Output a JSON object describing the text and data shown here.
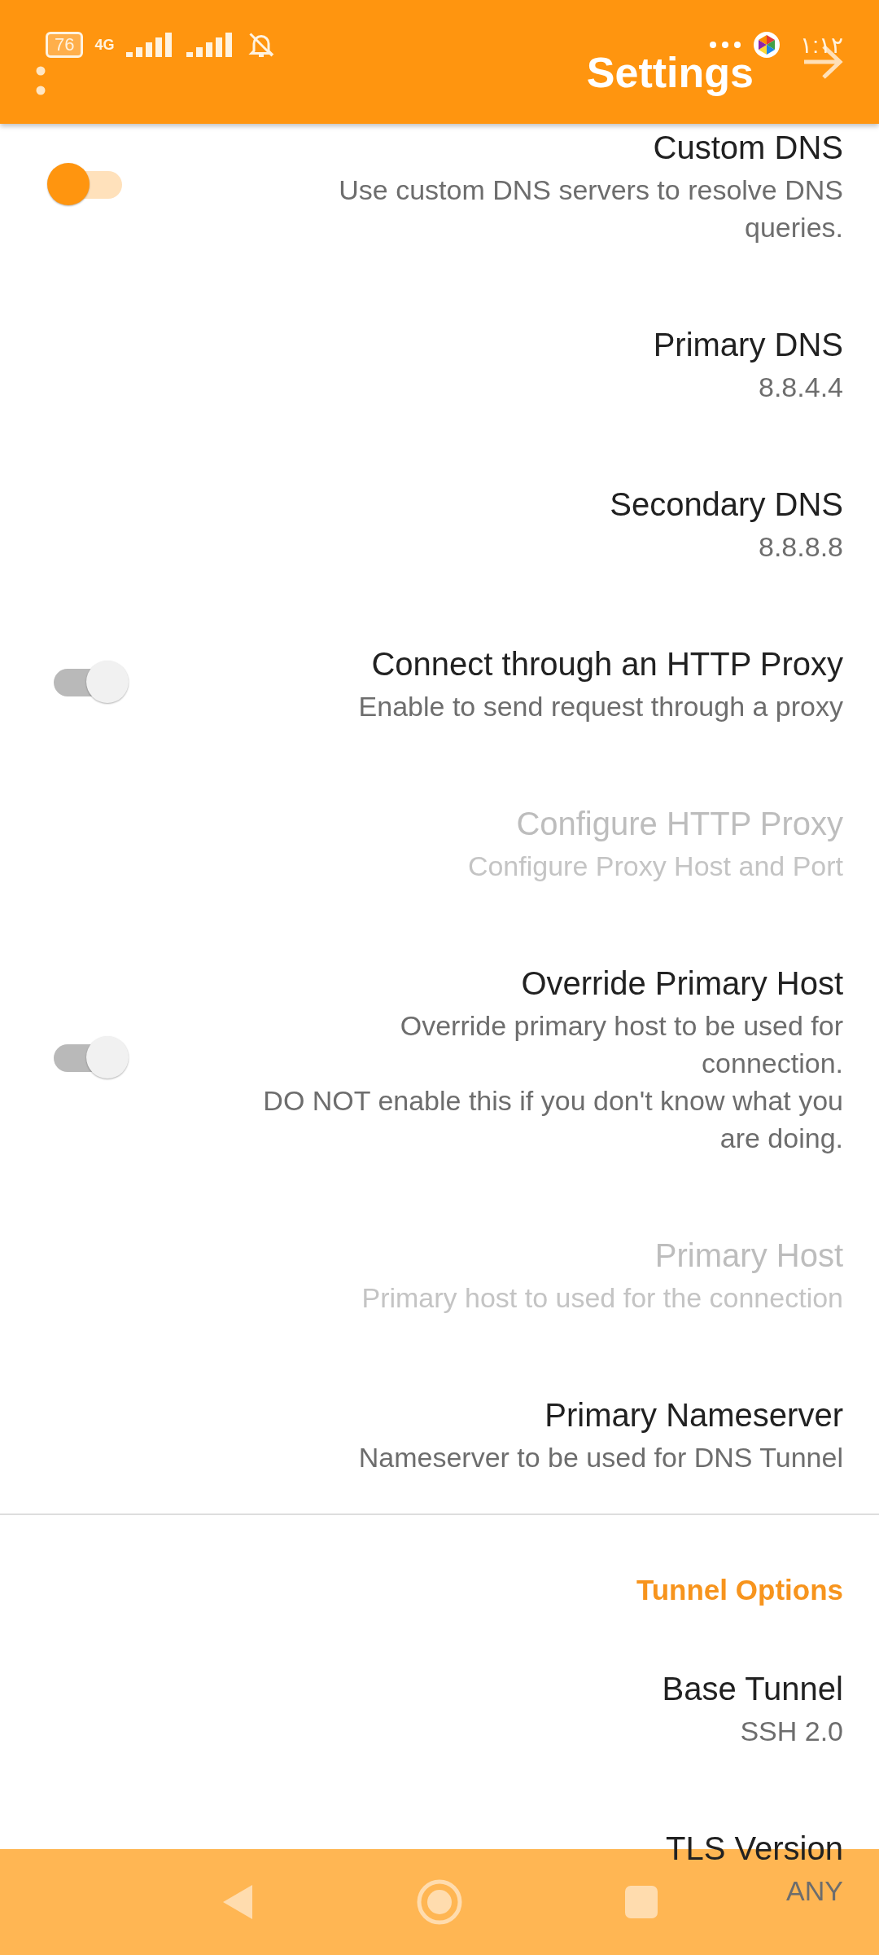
{
  "status_bar": {
    "battery": "76",
    "network": "4G",
    "time": "١:١٢"
  },
  "app_bar": {
    "title": "Settings"
  },
  "preferences": [
    {
      "kind": "switch",
      "title": "Custom DNS",
      "summary": "Use custom DNS servers to resolve DNS queries.",
      "on": true,
      "disabled": false
    },
    {
      "kind": "text",
      "title": "Primary DNS",
      "summary": "8.8.4.4",
      "disabled": false
    },
    {
      "kind": "text",
      "title": "Secondary DNS",
      "summary": "8.8.8.8",
      "disabled": false
    },
    {
      "kind": "switch",
      "title": "Connect through an HTTP Proxy",
      "summary": "Enable to send request through a proxy",
      "on": false,
      "disabled": false
    },
    {
      "kind": "text",
      "title": "Configure HTTP Proxy",
      "summary": "Configure Proxy Host and Port",
      "disabled": true
    },
    {
      "kind": "switch",
      "title": "Override Primary Host",
      "summary": "Override primary host to be used for connection.\nDO NOT enable this if you don't know what you are doing.",
      "on": false,
      "disabled": false
    },
    {
      "kind": "text",
      "title": "Primary Host",
      "summary": "Primary host to used for the connection",
      "disabled": true
    },
    {
      "kind": "text",
      "title": "Primary Nameserver",
      "summary": "Nameserver to be used for DNS Tunnel",
      "disabled": false
    },
    {
      "kind": "category",
      "title": "Tunnel Options"
    },
    {
      "kind": "text",
      "title": "Base Tunnel",
      "summary": "SSH 2.0",
      "disabled": false
    },
    {
      "kind": "text",
      "title": "TLS Version",
      "summary": "ANY",
      "disabled": false
    }
  ]
}
